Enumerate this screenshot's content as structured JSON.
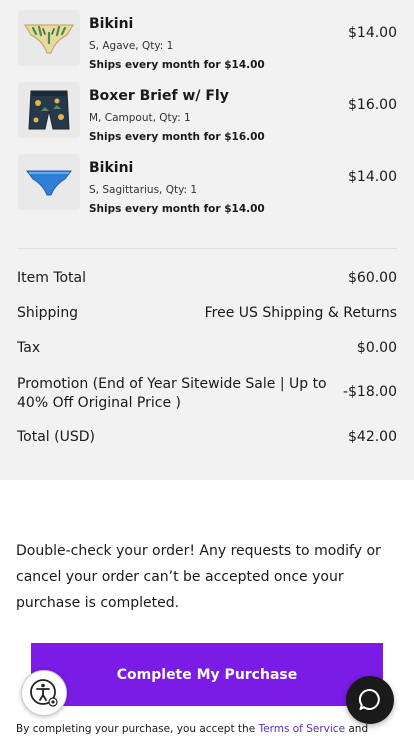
{
  "items": [
    {
      "name": "Bikini",
      "variant": "S, Agave, Qty: 1",
      "shipping": "Ships every month for $14.00",
      "price": "$14.00",
      "image_icon": "agave-print-bikini"
    },
    {
      "name": "Boxer Brief w/ Fly",
      "variant": "M, Campout, Qty: 1",
      "shipping": "Ships every month for $16.00",
      "price": "$16.00",
      "image_icon": "campout-print-boxer-brief"
    },
    {
      "name": "Bikini",
      "variant": "S, Sagittarius, Qty: 1",
      "shipping": "Ships every month for $14.00",
      "price": "$14.00",
      "image_icon": "blue-bikini"
    }
  ],
  "totals": {
    "item_total_label": "Item Total",
    "item_total_value": "$60.00",
    "shipping_label": "Shipping",
    "shipping_value": "Free US Shipping & Returns",
    "tax_label": "Tax",
    "tax_value": "$0.00",
    "promotion_label": "Promotion (End of Year Sitewide Sale | Up to 40% Off Original Price )",
    "promotion_value": "-$18.00",
    "total_label": "Total (USD)",
    "total_value": "$42.00"
  },
  "notice": "Double-check your order! Any requests to modify or cancel your order can’t be accepted once your purchase is completed.",
  "cta": {
    "label": "Complete My Purchase"
  },
  "terms": {
    "prefix": "By completing your purchase, you accept the ",
    "link": "Terms of Service",
    "suffix": " and"
  },
  "widgets": {
    "accessibility_icon": "accessibility-icon",
    "chat_icon": "chat-bubble-icon"
  },
  "colors": {
    "summary_bg": "#f2f2f2",
    "cta_bg": "#7a1be6",
    "link": "#5a2ac0",
    "chat_bg": "#1a1a1a"
  }
}
